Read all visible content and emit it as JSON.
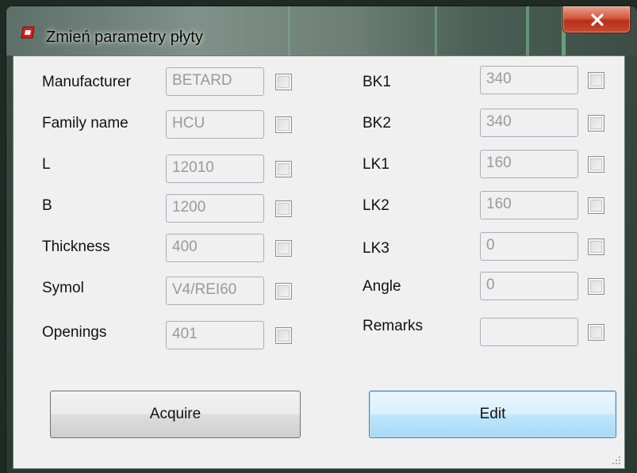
{
  "window": {
    "title": "Zmień parametry płyty",
    "close_symbol": "x",
    "icon": "app-logo-icon"
  },
  "left_fields": [
    {
      "label": "Manufacturer",
      "value": "BETARD"
    },
    {
      "label": "Family name",
      "value": "HCU"
    },
    {
      "label": "L",
      "value": "12010"
    },
    {
      "label": "B",
      "value": "1200"
    },
    {
      "label": "Thickness",
      "value": "400"
    },
    {
      "label": "Symol",
      "value": "V4/REI60"
    },
    {
      "label": "Openings",
      "value": "401"
    }
  ],
  "right_fields": [
    {
      "label": "BK1",
      "value": "340"
    },
    {
      "label": "BK2",
      "value": "340"
    },
    {
      "label": "LK1",
      "value": "160"
    },
    {
      "label": "LK2",
      "value": "160"
    },
    {
      "label": "LK3",
      "value": "0"
    },
    {
      "label": "Angle",
      "value": "0"
    },
    {
      "label": "Remarks",
      "value": ""
    }
  ],
  "buttons": {
    "acquire_label": "Acquire",
    "edit_label": "Edit"
  },
  "colors": {
    "close_button": "#c64a30",
    "field_text": "#9a9a9a",
    "edit_border": "#3c7fb1"
  }
}
